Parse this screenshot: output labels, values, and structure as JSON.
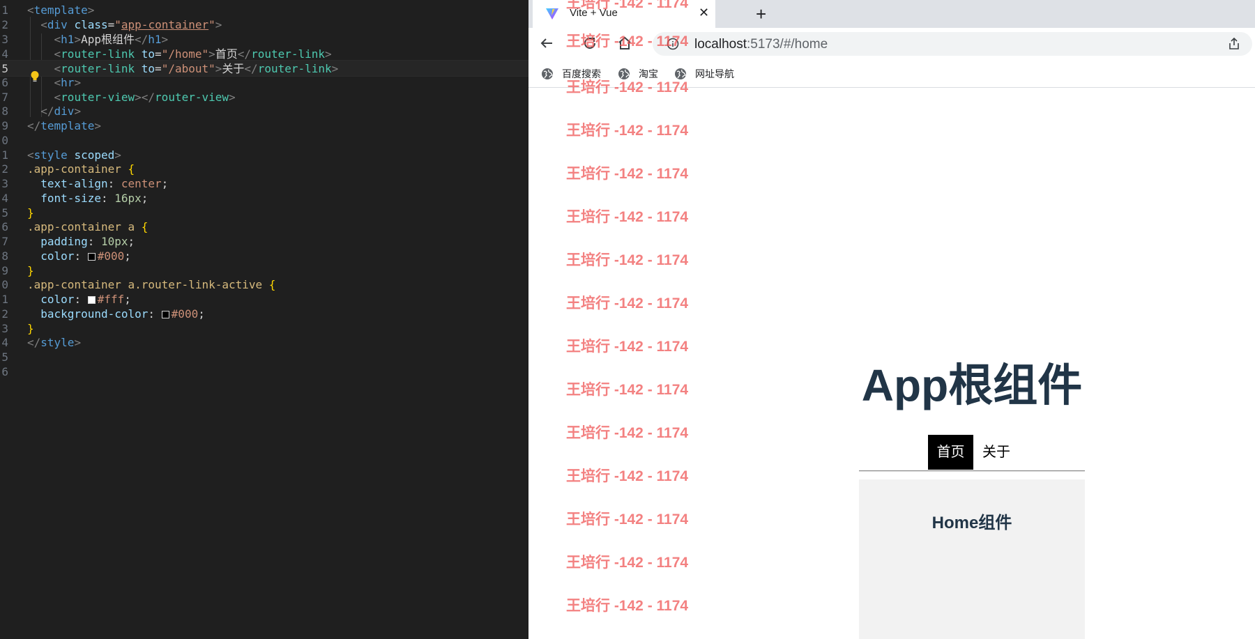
{
  "editor": {
    "line_numbers": [
      "1",
      "2",
      "3",
      "4",
      "5",
      "6",
      "7",
      "8",
      "9",
      "0",
      "1",
      "2",
      "3",
      "4",
      "5",
      "6",
      "7",
      "8",
      "9",
      "0",
      "1",
      "2",
      "3",
      "4",
      "5",
      "6"
    ],
    "template_open": "template",
    "div_tag": "div",
    "class_attr": "class",
    "class_value": "app-container",
    "h1_tag": "h1",
    "h1_text": "App根组件",
    "router_link_tag": "router-link",
    "to_attr": "to",
    "link1_to": "/home",
    "link1_text": "首页",
    "link2_to": "/about",
    "link2_text": "关于",
    "hr_tag": "hr",
    "router_view_tag": "router-view",
    "style_tag": "style",
    "scoped_attr": "scoped",
    "sel1": ".app-container",
    "sel2": ".app-container a",
    "sel3": ".app-container a.router-link-active",
    "prop_text_align": "text-align",
    "val_center": "center",
    "prop_font_size": "font-size",
    "val_16px": "16px",
    "prop_padding": "padding",
    "val_10px": "10px",
    "prop_color": "color",
    "val_000": "#000",
    "val_fff": "#fff",
    "prop_bg": "background-color",
    "open_brace": "{",
    "close_brace": "}",
    "semicolon": ";",
    "colon": ":"
  },
  "browser": {
    "tab_title": "Vite + Vue",
    "tab_close": "✕",
    "new_tab": "+",
    "url_host": "localhost",
    "url_rest": ":5173/#/home",
    "bookmarks": [
      {
        "label": "百度搜索",
        "icon": "globe-icon"
      },
      {
        "label": "淘宝",
        "icon": "globe-icon"
      },
      {
        "label": "网址导航",
        "icon": "globe-icon"
      }
    ]
  },
  "page": {
    "title": "App根组件",
    "nav_home": "首页",
    "nav_about": "关于",
    "home_component_title": "Home组件"
  },
  "watermark": {
    "text": "王培行 -142 - 1174"
  },
  "colors": {
    "editor_bg": "#1f1f1f",
    "vue_text": "#213547",
    "active_link_bg": "#000000",
    "watermark": "#ee5050"
  }
}
